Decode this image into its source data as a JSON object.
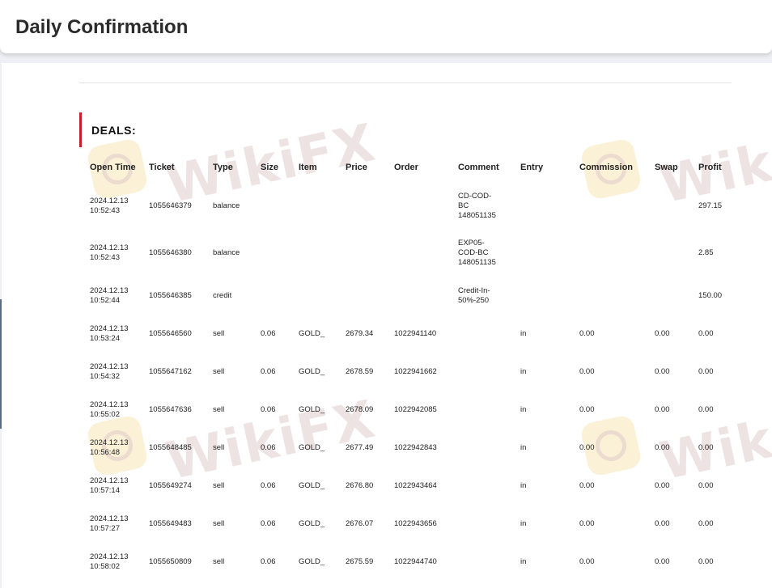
{
  "header": {
    "title": "Daily Confirmation"
  },
  "section": {
    "title": "DEALS:"
  },
  "watermark": {
    "text": "WikiFX"
  },
  "colors": {
    "accent": "#c8202b"
  },
  "table": {
    "headers": [
      "Open Time",
      "Ticket",
      "Type",
      "Size",
      "Item",
      "Price",
      "Order",
      "Comment",
      "Entry",
      "Commission",
      "Swap",
      "Profit"
    ],
    "rows": [
      {
        "date": "2024.12.13",
        "time": "10:52:43",
        "ticket": "1055646379",
        "type": "balance",
        "size": "",
        "item": "",
        "price": "",
        "order": "",
        "comment": "CD-COD-BC 148051135",
        "entry": "",
        "commission": "",
        "swap": "",
        "profit": "297.15"
      },
      {
        "date": "2024.12.13",
        "time": "10:52:43",
        "ticket": "1055646380",
        "type": "balance",
        "size": "",
        "item": "",
        "price": "",
        "order": "",
        "comment": "EXP05-COD-BC 148051135",
        "entry": "",
        "commission": "",
        "swap": "",
        "profit": "2.85"
      },
      {
        "date": "2024.12.13",
        "time": "10:52:44",
        "ticket": "1055646385",
        "type": "credit",
        "size": "",
        "item": "",
        "price": "",
        "order": "",
        "comment": "Credit-In-50%-250",
        "entry": "",
        "commission": "",
        "swap": "",
        "profit": "150.00"
      },
      {
        "date": "2024.12.13",
        "time": "10:53:24",
        "ticket": "1055646560",
        "type": "sell",
        "size": "0.06",
        "item": "GOLD_",
        "price": "2679.34",
        "order": "1022941140",
        "comment": "",
        "entry": "in",
        "commission": "0.00",
        "swap": "0.00",
        "profit": "0.00"
      },
      {
        "date": "2024.12.13",
        "time": "10:54:32",
        "ticket": "1055647162",
        "type": "sell",
        "size": "0.06",
        "item": "GOLD_",
        "price": "2678.59",
        "order": "1022941662",
        "comment": "",
        "entry": "in",
        "commission": "0.00",
        "swap": "0.00",
        "profit": "0.00"
      },
      {
        "date": "2024.12.13",
        "time": "10:55:02",
        "ticket": "1055647636",
        "type": "sell",
        "size": "0.06",
        "item": "GOLD_",
        "price": "2678.09",
        "order": "1022942085",
        "comment": "",
        "entry": "in",
        "commission": "0.00",
        "swap": "0.00",
        "profit": "0.00"
      },
      {
        "date": "2024.12.13",
        "time": "10:56:48",
        "ticket": "1055648485",
        "type": "sell",
        "size": "0.06",
        "item": "GOLD_",
        "price": "2677.49",
        "order": "1022942843",
        "comment": "",
        "entry": "in",
        "commission": "0.00",
        "swap": "0.00",
        "profit": "0.00"
      },
      {
        "date": "2024.12.13",
        "time": "10:57:14",
        "ticket": "1055649274",
        "type": "sell",
        "size": "0.06",
        "item": "GOLD_",
        "price": "2676.80",
        "order": "1022943464",
        "comment": "",
        "entry": "in",
        "commission": "0.00",
        "swap": "0.00",
        "profit": "0.00"
      },
      {
        "date": "2024.12.13",
        "time": "10:57:27",
        "ticket": "1055649483",
        "type": "sell",
        "size": "0.06",
        "item": "GOLD_",
        "price": "2676.07",
        "order": "1022943656",
        "comment": "",
        "entry": "in",
        "commission": "0.00",
        "swap": "0.00",
        "profit": "0.00"
      },
      {
        "date": "2024.12.13",
        "time": "10:58:02",
        "ticket": "1055650809",
        "type": "sell",
        "size": "0.06",
        "item": "GOLD_",
        "price": "2675.59",
        "order": "1022944740",
        "comment": "",
        "entry": "in",
        "commission": "0.00",
        "swap": "0.00",
        "profit": "0.00"
      }
    ]
  }
}
